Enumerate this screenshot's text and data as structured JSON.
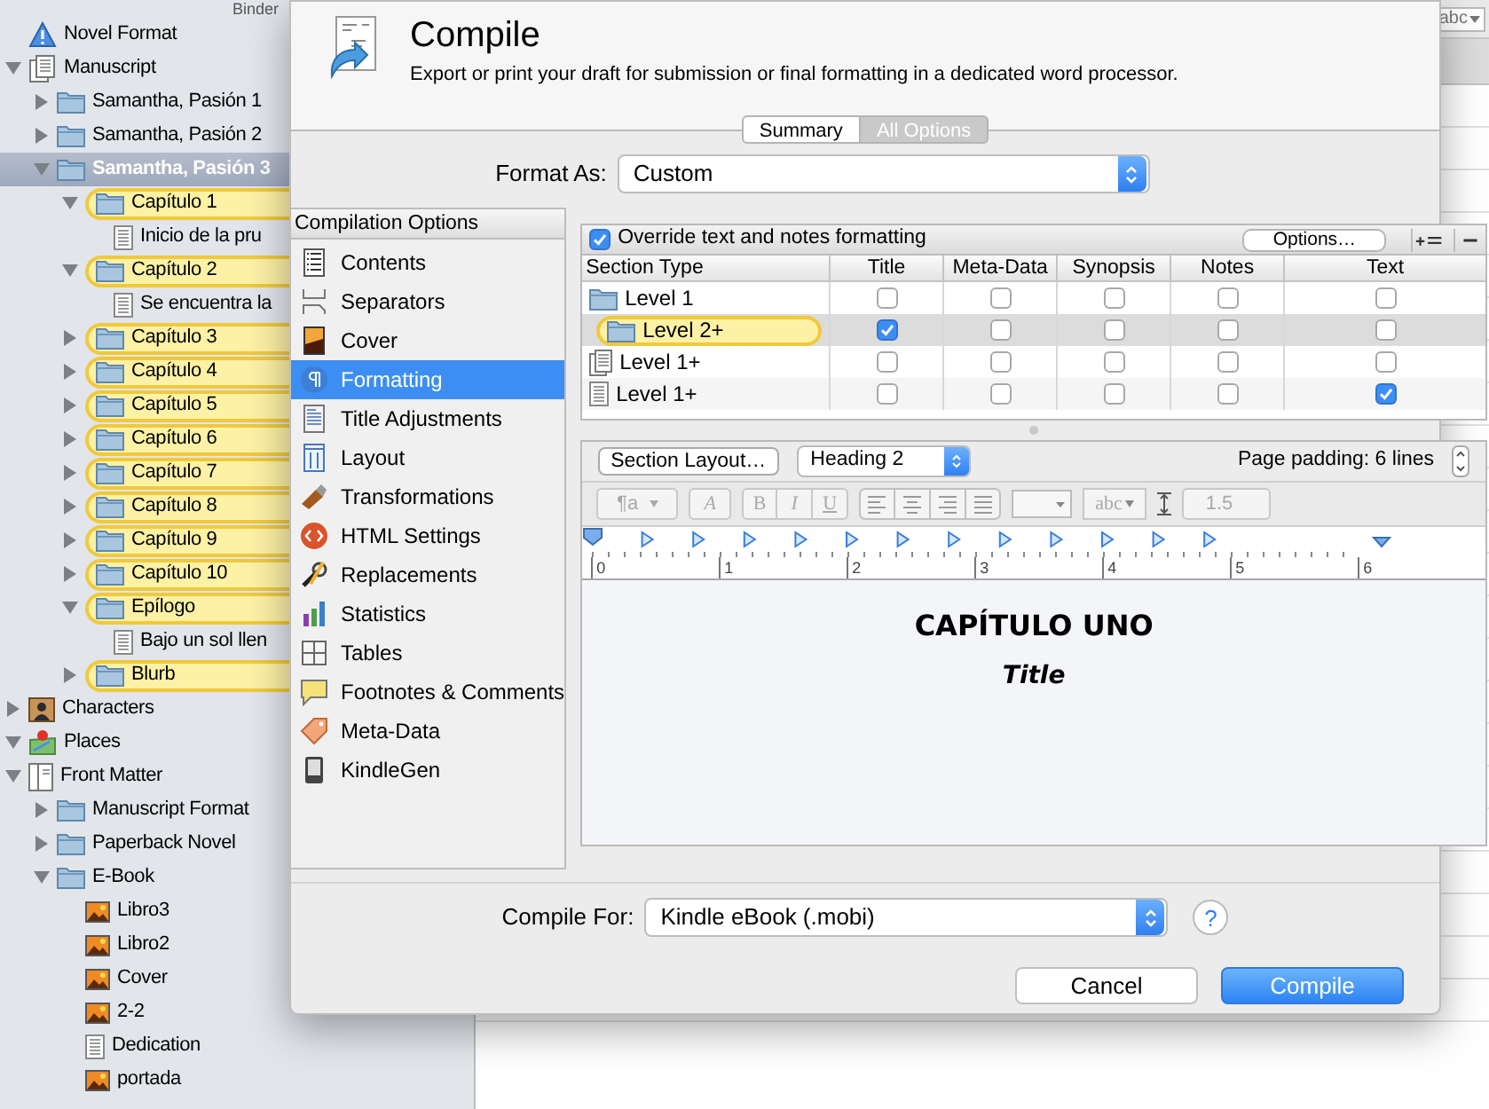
{
  "binder": {
    "title": "Binder",
    "items": [
      {
        "label": "Novel Format",
        "kind": "format",
        "selected": false,
        "highlighted": false
      },
      {
        "label": "Manuscript",
        "kind": "draft",
        "selected": false,
        "highlighted": false,
        "expanded": true,
        "children": [
          {
            "label": "Samantha, Pasión 1",
            "kind": "folder",
            "selected": false,
            "highlighted": false,
            "expanded": false
          },
          {
            "label": "Samantha, Pasión 2",
            "kind": "folder",
            "selected": false,
            "highlighted": false,
            "expanded": false
          },
          {
            "label": "Samantha, Pasión 3",
            "kind": "folder",
            "selected": true,
            "highlighted": false,
            "expanded": true,
            "children": [
              {
                "label": "Capítulo 1",
                "kind": "folder",
                "selected": false,
                "highlighted": true,
                "expanded": true,
                "children": [
                  {
                    "label": "Inicio de la pru",
                    "kind": "doc",
                    "selected": false,
                    "highlighted": false
                  }
                ]
              },
              {
                "label": "Capítulo 2",
                "kind": "folder",
                "selected": false,
                "highlighted": true,
                "expanded": true,
                "children": [
                  {
                    "label": "Se encuentra la",
                    "kind": "doc",
                    "selected": false,
                    "highlighted": false
                  }
                ]
              },
              {
                "label": "Capítulo 3",
                "kind": "folder",
                "selected": false,
                "highlighted": true,
                "expanded": false
              },
              {
                "label": "Capítulo 4",
                "kind": "folder",
                "selected": false,
                "highlighted": true,
                "expanded": false
              },
              {
                "label": "Capítulo 5",
                "kind": "folder",
                "selected": false,
                "highlighted": true,
                "expanded": false
              },
              {
                "label": "Capítulo 6",
                "kind": "folder",
                "selected": false,
                "highlighted": true,
                "expanded": false
              },
              {
                "label": "Capítulo 7",
                "kind": "folder",
                "selected": false,
                "highlighted": true,
                "expanded": false
              },
              {
                "label": "Capítulo 8",
                "kind": "folder",
                "selected": false,
                "highlighted": true,
                "expanded": false
              },
              {
                "label": "Capítulo 9",
                "kind": "folder",
                "selected": false,
                "highlighted": true,
                "expanded": false
              },
              {
                "label": "Capítulo 10",
                "kind": "folder",
                "selected": false,
                "highlighted": true,
                "expanded": false
              },
              {
                "label": "Epílogo",
                "kind": "folder",
                "selected": false,
                "highlighted": true,
                "expanded": true,
                "children": [
                  {
                    "label": "Bajo un sol llen",
                    "kind": "doc",
                    "selected": false,
                    "highlighted": false
                  }
                ]
              },
              {
                "label": "Blurb",
                "kind": "folder",
                "selected": false,
                "highlighted": true,
                "expanded": false
              }
            ]
          }
        ]
      },
      {
        "label": "Characters",
        "kind": "characters",
        "selected": false,
        "highlighted": false,
        "expanded": false
      },
      {
        "label": "Places",
        "kind": "places",
        "selected": false,
        "highlighted": false,
        "expanded": true
      },
      {
        "label": "Front Matter",
        "kind": "frontmatter",
        "selected": false,
        "highlighted": false,
        "expanded": true,
        "children": [
          {
            "label": "Manuscript Format",
            "kind": "folder",
            "selected": false,
            "highlighted": false,
            "expanded": false
          },
          {
            "label": "Paperback Novel",
            "kind": "folder",
            "selected": false,
            "highlighted": false,
            "expanded": false
          },
          {
            "label": "E-Book",
            "kind": "folder",
            "selected": false,
            "highlighted": false,
            "expanded": true,
            "children": [
              {
                "label": "Libro3",
                "kind": "image",
                "selected": false,
                "highlighted": false
              },
              {
                "label": "Libro2",
                "kind": "image",
                "selected": false,
                "highlighted": false
              },
              {
                "label": "Cover",
                "kind": "image",
                "selected": false,
                "highlighted": false
              },
              {
                "label": "2-2",
                "kind": "image",
                "selected": false,
                "highlighted": false
              },
              {
                "label": "Dedication",
                "kind": "doc",
                "selected": false,
                "highlighted": false
              },
              {
                "label": "portada",
                "kind": "image",
                "selected": false,
                "highlighted": false
              }
            ]
          }
        ]
      }
    ]
  },
  "editor": {
    "font_menu": "abc"
  },
  "dialog": {
    "title": "Compile",
    "description": "Export or print your draft for submission or final formatting in a dedicated word processor.",
    "tabs": [
      {
        "label": "Summary",
        "selected": false
      },
      {
        "label": "All Options",
        "selected": true
      }
    ],
    "format_as": {
      "label": "Format As:",
      "value": "Custom"
    },
    "options_header": "Compilation Options",
    "options": [
      {
        "label": "Contents",
        "selected": false
      },
      {
        "label": "Separators",
        "selected": false
      },
      {
        "label": "Cover",
        "selected": false
      },
      {
        "label": "Formatting",
        "selected": true
      },
      {
        "label": "Title Adjustments",
        "selected": false
      },
      {
        "label": "Layout",
        "selected": false
      },
      {
        "label": "Transformations",
        "selected": false
      },
      {
        "label": "HTML Settings",
        "selected": false
      },
      {
        "label": "Replacements",
        "selected": false
      },
      {
        "label": "Statistics",
        "selected": false
      },
      {
        "label": "Tables",
        "selected": false
      },
      {
        "label": "Footnotes & Comments",
        "selected": false
      },
      {
        "label": "Meta-Data",
        "selected": false
      },
      {
        "label": "KindleGen",
        "selected": false
      }
    ],
    "override": {
      "label": "Override text and notes formatting",
      "checked": true,
      "button": "Options…"
    },
    "section_table": {
      "columns": [
        "Section Type",
        "Title",
        "Meta-Data",
        "Synopsis",
        "Notes",
        "Text"
      ],
      "rows": [
        {
          "label": "Level 1",
          "kind": "folder",
          "highlighted": false,
          "selected": false,
          "checks": [
            false,
            false,
            false,
            false,
            false
          ]
        },
        {
          "label": "Level 2+",
          "kind": "folder",
          "highlighted": true,
          "selected": true,
          "checks": [
            true,
            false,
            false,
            false,
            false
          ]
        },
        {
          "label": "Level 1+",
          "kind": "stack",
          "highlighted": false,
          "selected": false,
          "checks": [
            false,
            false,
            false,
            false,
            false
          ]
        },
        {
          "label": "Level 1+",
          "kind": "doc",
          "highlighted": false,
          "selected": false,
          "checks": [
            false,
            false,
            false,
            false,
            true
          ]
        }
      ]
    },
    "format_bar": {
      "section_layout": "Section Layout…",
      "style": "Heading 2",
      "page_padding": "Page padding: 6 lines"
    },
    "text_toolbar": {
      "paragraph": "¶a",
      "font": "A",
      "bold": "B",
      "italic": "I",
      "underline": "U",
      "highlight": "abc",
      "line_spacing": "1.5"
    },
    "ruler": [
      "0",
      "1",
      "2",
      "3",
      "4",
      "5",
      "6"
    ],
    "preview": {
      "heading": "CAPÍTULO UNO",
      "title": "Title"
    },
    "compile_for": {
      "label": "Compile For:",
      "value": "Kindle eBook (.mobi)",
      "help": "?"
    },
    "buttons": [
      {
        "label": "Cancel",
        "kind": "cancel"
      },
      {
        "label": "Compile",
        "kind": "default"
      }
    ]
  }
}
